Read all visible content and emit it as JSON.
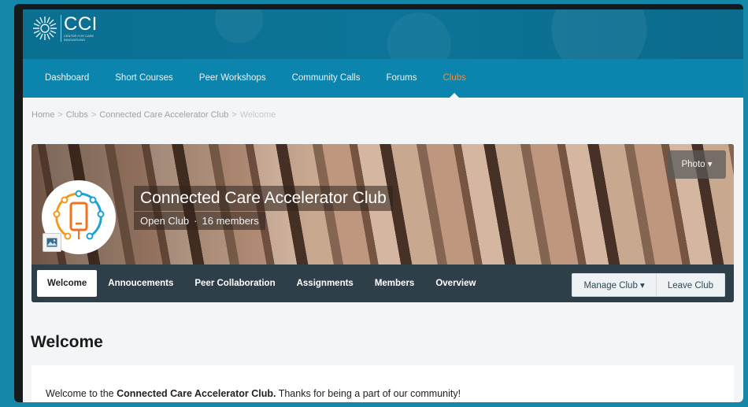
{
  "brand": {
    "title": "CCI",
    "subtitle": "CENTER FOR CARE INNOVATIONS",
    "color": "#0b85ad"
  },
  "nav": {
    "items": [
      {
        "label": "Dashboard"
      },
      {
        "label": "Short Courses"
      },
      {
        "label": "Peer Workshops"
      },
      {
        "label": "Community Calls"
      },
      {
        "label": "Forums"
      },
      {
        "label": "Clubs",
        "active": true
      }
    ],
    "active_color": "#f08c3d"
  },
  "breadcrumb": {
    "items": [
      "Home",
      "Clubs",
      "Connected Care Accelerator Club",
      "Welcome"
    ],
    "separator": ">"
  },
  "banner": {
    "photo_button": "Photo ▾",
    "club_name": "Connected Care Accelerator Club",
    "club_type": "Open Club",
    "separator": "·",
    "members": "16 members",
    "avatar_icon": "connected-phone-icon",
    "edit_icon": "image-icon"
  },
  "tabs": {
    "items": [
      {
        "label": "Welcome",
        "active": true
      },
      {
        "label": "Annoucements"
      },
      {
        "label": "Peer Collaboration"
      },
      {
        "label": "Assignments"
      },
      {
        "label": "Members"
      },
      {
        "label": "Overview"
      }
    ],
    "manage_label": "Manage Club ▾",
    "leave_label": "Leave Club"
  },
  "main": {
    "heading": "Welcome",
    "text_before": "Welcome to the ",
    "text_bold": "Connected Care Accelerator Club.",
    "text_after": " Thanks for being a part of our community!"
  }
}
